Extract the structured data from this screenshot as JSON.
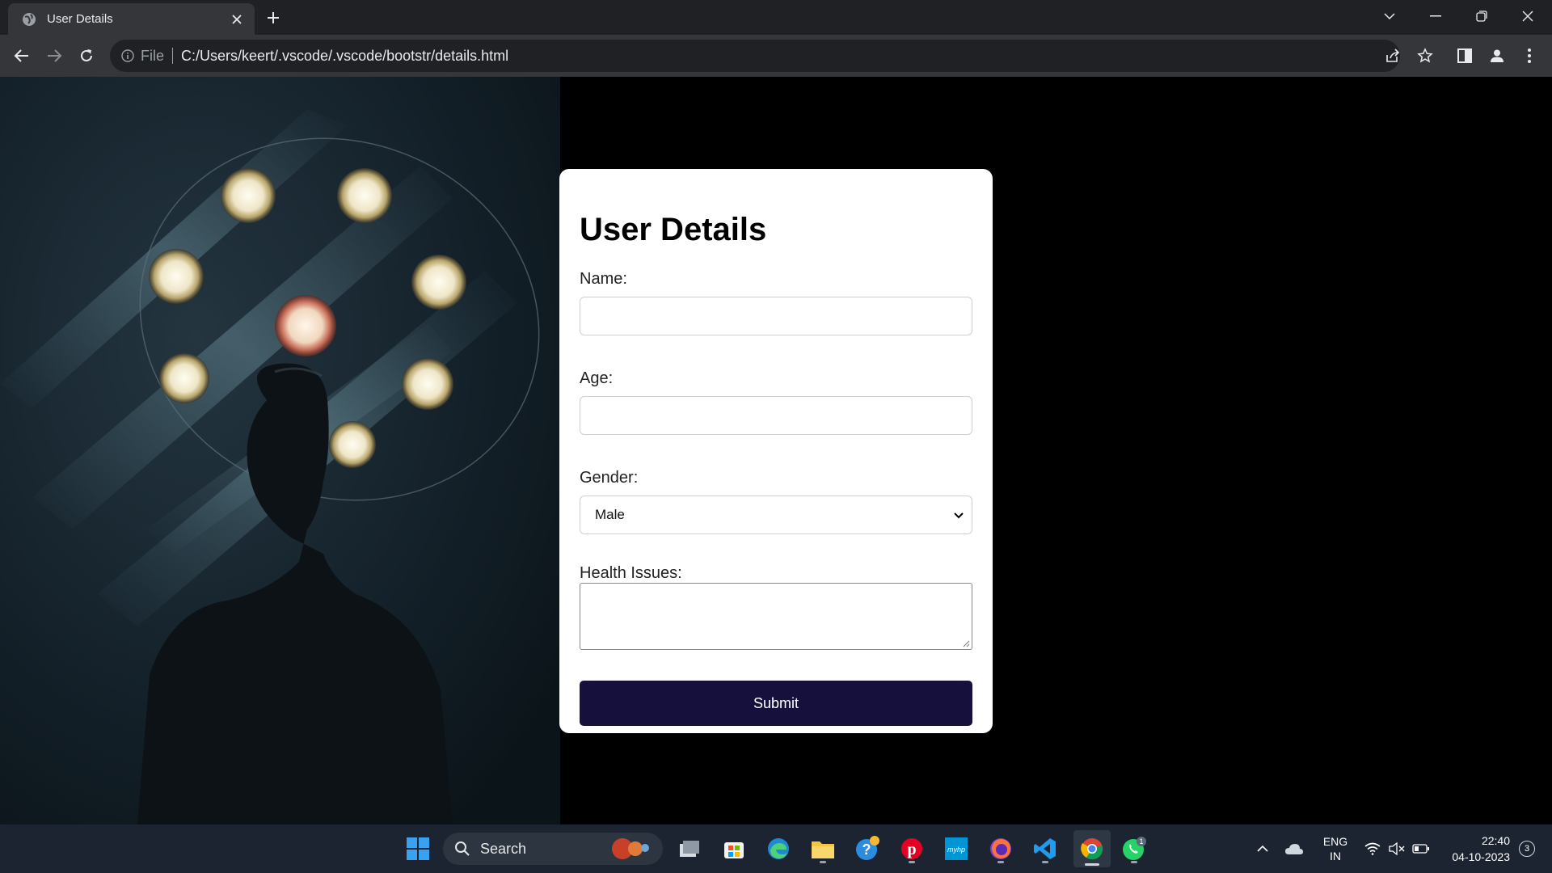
{
  "browser": {
    "tab_title": "User Details",
    "address": {
      "scheme_label": "File",
      "url": "C:/Users/keert/.vscode/.vscode/bootstr/details.html"
    }
  },
  "form": {
    "heading": "User Details",
    "name_label": "Name:",
    "name_value": "",
    "age_label": "Age:",
    "age_value": "",
    "gender_label": "Gender:",
    "gender_selected": "Male",
    "health_label": "Health Issues:",
    "health_value": "",
    "submit_label": "Submit",
    "submit_color": "#15103c"
  },
  "taskbar": {
    "search_label": "Search",
    "lang_line1": "ENG",
    "lang_line2": "IN",
    "time": "22:40",
    "date": "04-10-2023",
    "notifications": "3",
    "whatsapp_badge": "1",
    "apps": [
      "start-icon",
      "search-icon",
      "task-view-icon",
      "store-icon",
      "edge-icon",
      "file-explorer-icon",
      "help-icon",
      "pinterest-icon",
      "myhp-icon",
      "firefox-icon",
      "vscode-icon",
      "chrome-icon",
      "whatsapp-icon"
    ]
  }
}
